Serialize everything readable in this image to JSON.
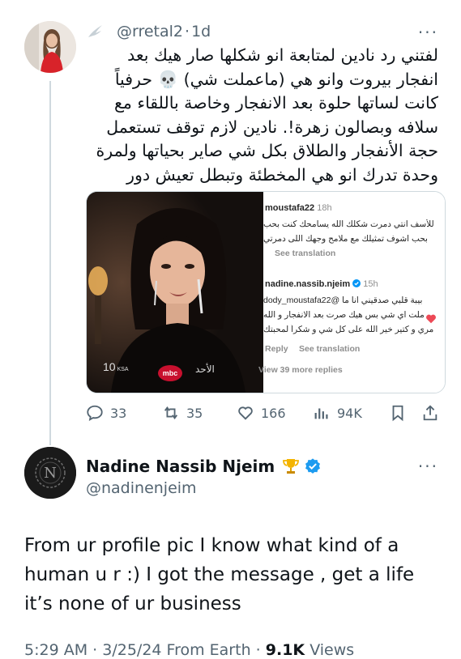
{
  "original_tweet": {
    "handle": "@rretal2",
    "separator": "·",
    "time": "1d",
    "text": "لفتني رد نادين لمتابعة انو شكلها صار هيك بعد انفجار بيروت وانو هي (ماعملت شي) 💀 حرفياً كانت لساتها حلوة بعد الانفجار وخاصة باللقاء مع سلافه وبصالون زهرة!. نادين لازم توقف تستعمل حجة الأنفجار والطلاق بكل شي صاير بحياتها ولمرة وحدة تدرك انو هي المخطئة وتبطل تعيش دور الضحية",
    "more_label": "···"
  },
  "media": {
    "video": {
      "channel_number": "10",
      "channel_tag": "KSA",
      "network_logo": "mbc",
      "day_label": "الأحد"
    },
    "comments": [
      {
        "user": "moustafa22",
        "time": "18h",
        "line1": "للأسف انتي دمرت شكلك الله يسامحك كنت بحب",
        "line2": "بحب اشوف تمثيلك مع ملامح وجهك اللى دمرتي",
        "see_translation": "See translation"
      },
      {
        "user": "nadine.nassib.njeim",
        "time": "15h",
        "line1": "بيبة قلبي صدقيني انا ما @dody_moustafa22",
        "line2": "ملت اي شي بس هيك صرت بعد الانفجار و الله",
        "line3": "مري و كتير خير الله على كل شي و شكراً لمحبتك",
        "reply": "Reply",
        "see_translation": "See translation"
      }
    ],
    "view_replies": "View 39 more replies"
  },
  "actions": {
    "replies": "33",
    "retweets": "35",
    "likes": "166",
    "views": "94K"
  },
  "reply_tweet": {
    "display_name": "Nadine Nassib Njeim",
    "handle": "@nadinenjeim",
    "avatar_letter": "N",
    "text": "From ur profile pic I know what kind of a human u r :) I got the message , get a life it’s none of ur business",
    "more_label": "···"
  },
  "footer": {
    "time": "5:29 AM",
    "date": "3/25/24",
    "source": "From Earth",
    "dot": "·",
    "views_count": "9.1K",
    "views_label": "Views"
  },
  "colors": {
    "text": "#0f1419",
    "secondary": "#536471",
    "verified": "#1d9bf0",
    "link": "#00376b",
    "thread_line": "#cfd9de"
  }
}
